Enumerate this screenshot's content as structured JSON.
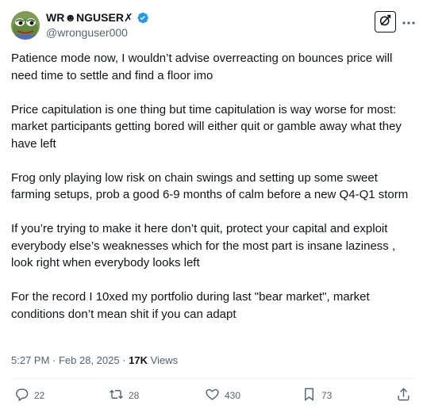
{
  "author": {
    "display_name": "WR☻NGUSER✗",
    "handle": "@wronguser000",
    "verified": true
  },
  "post": {
    "paragraphs": [
      "Patience mode now, I wouldn’t advise overreacting on bounces price will need time to settle and find a floor imo",
      "Price capitulation is one thing but time capitulation is way worse for most: market participants getting bored will either quit or gamble away what they have left",
      "Frog only playing low risk on chain swings and setting up some sweet farming setups, prob a good 6-9 months of calm before a new Q4-Q1 storm",
      "If you’re trying to make it here don’t quit, protect your capital and exploit everybody else’s weaknesses which for the most part is insane laziness , look right when everybody looks left",
      "For the record I 10xed my portfolio during last \"bear market\", market conditions don’t mean shit if you can adapt"
    ],
    "timestamp": "5:27 PM · Feb 28, 2025",
    "views_count": "17K",
    "views_label": "Views"
  },
  "actions": {
    "replies": "22",
    "reposts": "28",
    "likes": "430",
    "bookmarks": "73"
  },
  "icons": {
    "verified": "verified-badge-icon",
    "grok": "grok-icon",
    "more": "more-icon",
    "reply": "reply-icon",
    "repost": "repost-icon",
    "like": "heart-icon",
    "bookmark": "bookmark-icon",
    "share": "share-icon"
  },
  "colors": {
    "text": "#0f1419",
    "secondary": "#536471",
    "verified": "#1d9bf0",
    "divider": "#eff3f4"
  }
}
